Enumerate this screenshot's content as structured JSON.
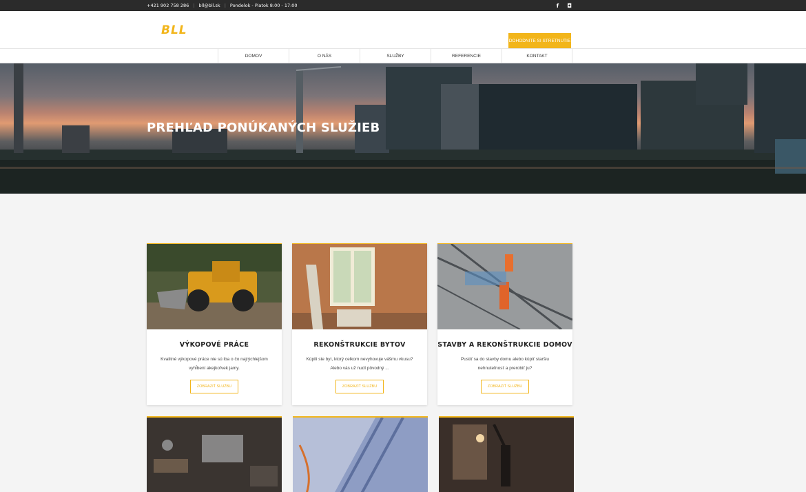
{
  "topbar": {
    "phone": "+421 902 758 286",
    "email": "bll@bll.sk",
    "hours": "Pondelok - Piatok 8:00 - 17:00",
    "social": [
      "f",
      "◘"
    ]
  },
  "header": {
    "logo": "BLL",
    "cta_label": "DOHODNITE SI STRETNUTIE"
  },
  "nav": {
    "items": [
      "DOMOV",
      "O NÁS",
      "SLUŽBY",
      "REFERENCIE",
      "KONTAKT"
    ]
  },
  "hero": {
    "title": "PREHĽAD PONÚKANÝCH SLUŽIEB"
  },
  "cards": [
    {
      "title": "VÝKOPOVÉ PRÁCE",
      "text": "Kvalitné výkopové práce nie sú iba o čo najrýchlejšom vyhĺbení akejkoľvek jamy.",
      "button": "ZOBRAZIŤ SLUŽBU"
    },
    {
      "title": "REKONŠTRUKCIE BYTOV",
      "text": "Kúpili ste byt, ktorý celkom nevyhovuje vášmu vkusu? Alebo vás už nudí pôvodný ...",
      "button": "ZOBRAZIŤ SLUŽBU"
    },
    {
      "title": "STAVBY A REKONŠTRUKCIE DOMOV",
      "text": "Pustiť sa do stavby domu alebo kúpiť staršiu nehnuteľnosť a prerobiť ju?",
      "button": "ZOBRAZIŤ SLUŽBU"
    }
  ],
  "colors": {
    "accent": "#f2b51a",
    "topbar": "#2b2b2b",
    "background": "#f4f4f4"
  }
}
